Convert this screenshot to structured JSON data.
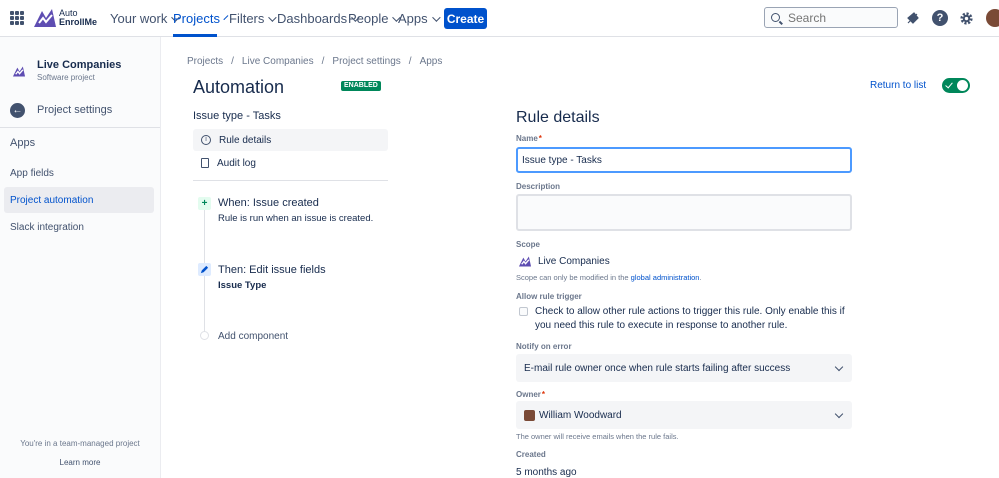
{
  "brand": {
    "line1": "Auto",
    "line2": "EnrollMe"
  },
  "nav": {
    "items": [
      {
        "label": "Your work"
      },
      {
        "label": "Projects"
      },
      {
        "label": "Filters"
      },
      {
        "label": "Dashboards"
      },
      {
        "label": "People"
      },
      {
        "label": "Apps"
      }
    ],
    "active": "Projects",
    "create_label": "Create",
    "search_placeholder": "Search",
    "help_glyph": "?"
  },
  "sidebar": {
    "project_name": "Live Companies",
    "project_type": "Software project",
    "back_label": "Project settings",
    "section_heading": "Apps",
    "links": [
      {
        "label": "App fields"
      },
      {
        "label": "Project automation"
      },
      {
        "label": "Slack integration"
      }
    ],
    "active_link": "Project automation",
    "footer_text": "You're in a team-managed project",
    "footer_link": "Learn more"
  },
  "breadcrumb": [
    "Projects",
    "Live Companies",
    "Project settings",
    "Apps"
  ],
  "page": {
    "title": "Automation",
    "status_badge": "ENABLED",
    "return_link": "Return to list",
    "rule_enabled": true
  },
  "rule": {
    "name": "Issue type - Tasks",
    "menu": [
      {
        "label": "Rule details",
        "icon": "info-icon"
      },
      {
        "label": "Audit log",
        "icon": "log-icon"
      }
    ],
    "trigger": {
      "title": "When: Issue created",
      "desc": "Rule is run when an issue is created.",
      "glyph": "+"
    },
    "action": {
      "title": "Then: Edit issue fields",
      "desc": "Issue Type"
    },
    "add_component": "Add component"
  },
  "details": {
    "heading": "Rule details",
    "name_label": "Name",
    "required_mark": "*",
    "name_value": "Issue type - Tasks",
    "description_label": "Description",
    "description_value": "",
    "scope_label": "Scope",
    "scope_value": "Live Companies",
    "scope_note_prefix": "Scope can only be modified in the",
    "scope_note_link": "global administration",
    "scope_note_suffix": ".",
    "allow_trigger_label": "Allow rule trigger",
    "allow_trigger_text": "Check to allow other rule actions to trigger this rule. Only enable this if you need this rule to execute in response to another rule.",
    "allow_trigger_checked": false,
    "notify_label": "Notify on error",
    "notify_value": "E-mail rule owner once when rule starts failing after success",
    "owner_label": "Owner",
    "owner_value": "William Woodward",
    "owner_note": "The owner will receive emails when the rule fails.",
    "created_label": "Created",
    "created_value": "5 months ago"
  },
  "colors": {
    "brand_purple": "#5e4db2",
    "primary": "#0052cc",
    "success": "#00875a",
    "focus": "#4c9aff"
  }
}
